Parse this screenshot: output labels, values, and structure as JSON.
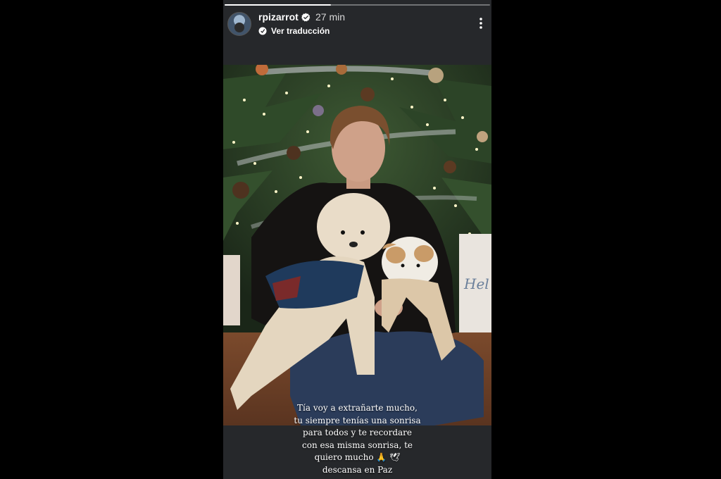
{
  "story": {
    "progress": 0.4,
    "username": "rpizarrot",
    "time": "27 min",
    "translate_label": "Ver traducción"
  },
  "caption": {
    "lines": [
      "Tía voy a extrañarte mucho,",
      "tu siempre tenías una sonrisa",
      "para todos  y te recordare",
      "con esa misma sonrisa, te",
      "quiero mucho 🙏 🕊",
      "descansa en Paz"
    ]
  },
  "photo": {
    "gift_box_text": "Hel"
  },
  "colors": {
    "background": "#000000",
    "story_panel": "#26282b",
    "text": "#ffffff"
  },
  "icons": [
    "verified-badge-icon",
    "translate-icon",
    "more-options-icon"
  ]
}
